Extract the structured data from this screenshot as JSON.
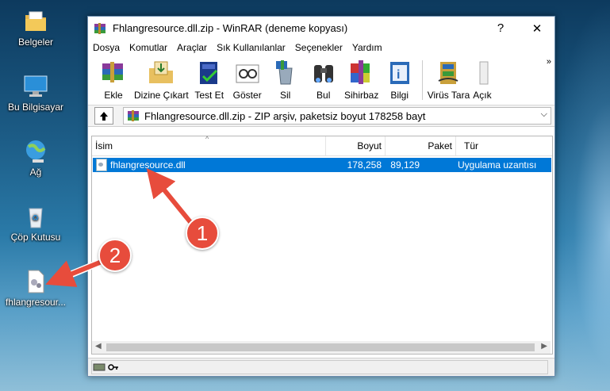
{
  "desktop": {
    "icons": [
      {
        "label": "Belgeler"
      },
      {
        "label": "Bu Bilgisayar"
      },
      {
        "label": "Ağ"
      },
      {
        "label": "Çöp Kutusu"
      },
      {
        "label": "fhlangresour..."
      }
    ]
  },
  "window": {
    "title": "Fhlangresource.dll.zip - WinRAR (deneme kopyası)",
    "help": "?",
    "close": "✕",
    "minimize": "—",
    "menu": [
      "Dosya",
      "Komutlar",
      "Araçlar",
      "Sık Kullanılanlar",
      "Seçenekler",
      "Yardım"
    ],
    "toolbar": [
      "Ekle",
      "Dizine Çıkart",
      "Test Et",
      "Göster",
      "Sil",
      "Bul",
      "Sihirbaz",
      "Bilgi",
      "Virüs Tara",
      "Açık"
    ],
    "more": "»",
    "address": "Fhlangresource.dll.zip - ZIP arşiv, paketsiz boyut 178258 bayt",
    "columns": {
      "name": "İsim",
      "size": "Boyut",
      "packed": "Paket",
      "type": "Tür"
    },
    "rows": [
      {
        "name": "fhlangresource.dll",
        "size": "178,258",
        "packed": "89,129",
        "type": "Uygulama uzantısı"
      }
    ]
  },
  "callouts": [
    "1",
    "2"
  ],
  "colors": {
    "selection": "#0078d7",
    "callout": "#e74c3c"
  }
}
